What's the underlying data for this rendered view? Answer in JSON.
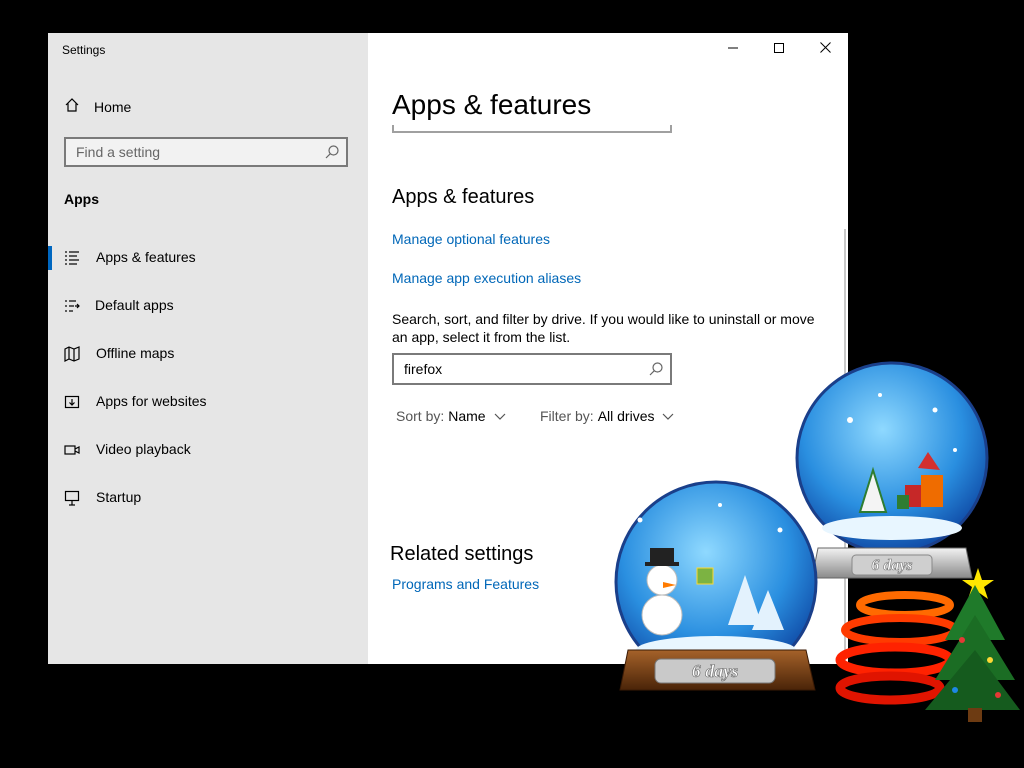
{
  "window": {
    "title": "Settings",
    "controls": {
      "minimize": "minimize",
      "maximize": "maximize",
      "close": "close"
    }
  },
  "sidebar": {
    "home_label": "Home",
    "search_placeholder": "Find a setting",
    "section_title": "Apps",
    "items": [
      {
        "label": "Apps & features",
        "icon": "apps-features-icon",
        "active": true
      },
      {
        "label": "Default apps",
        "icon": "default-apps-icon",
        "active": false
      },
      {
        "label": "Offline maps",
        "icon": "offline-maps-icon",
        "active": false
      },
      {
        "label": "Apps for websites",
        "icon": "apps-websites-icon",
        "active": false
      },
      {
        "label": "Video playback",
        "icon": "video-playback-icon",
        "active": false
      },
      {
        "label": "Startup",
        "icon": "startup-icon",
        "active": false
      }
    ]
  },
  "main": {
    "page_title": "Apps & features",
    "section_title": "Apps & features",
    "links": {
      "optional_features": "Manage optional features",
      "execution_aliases": "Manage app execution aliases"
    },
    "description": "Search, sort, and filter by drive. If you would like to uninstall or move an app, select it from the list.",
    "search_value": "firefox",
    "sort": {
      "label": "Sort by:",
      "value": "Name"
    },
    "filter": {
      "label": "Filter by:",
      "value": "All drives"
    },
    "related_title": "Related settings",
    "related_link": "Programs and Features"
  },
  "desktop_gadget": {
    "globe_left_caption": "6 days",
    "globe_right_caption": "6 days"
  },
  "colors": {
    "accent": "#0067c0",
    "link": "#0067b8",
    "sidebar_bg": "#e6e6e6",
    "desktop_bg": "#000000"
  }
}
